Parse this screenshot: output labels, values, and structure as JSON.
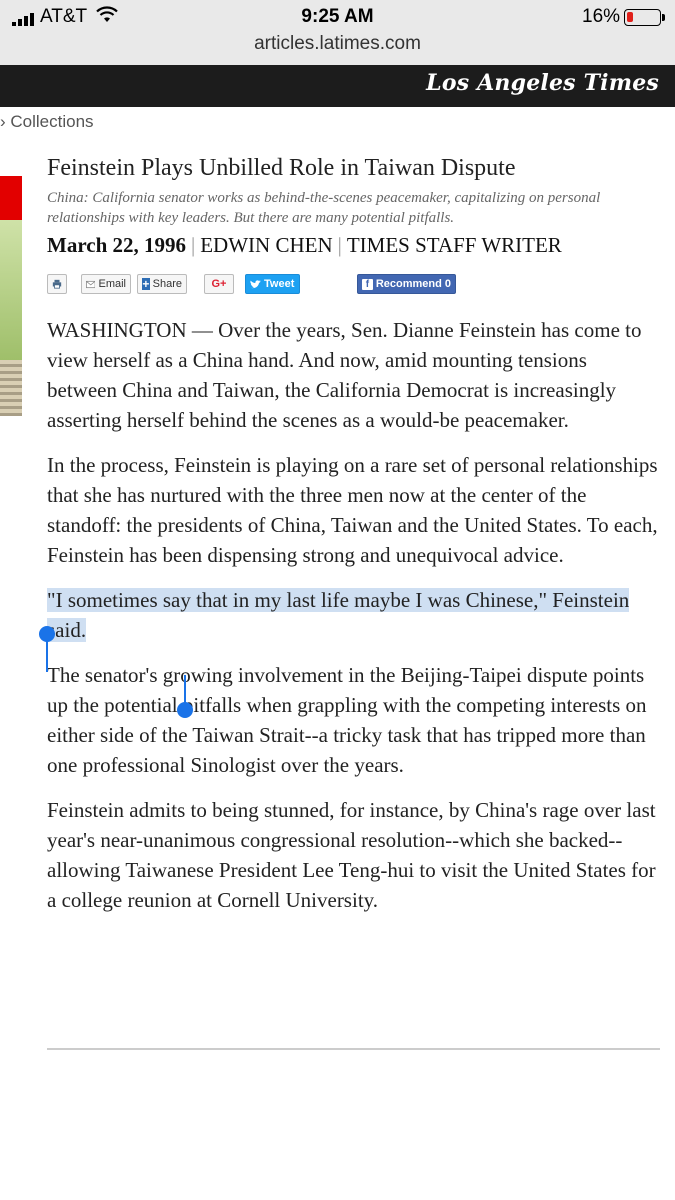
{
  "status_bar": {
    "carrier": "AT&T",
    "time": "9:25 AM",
    "battery": "16%"
  },
  "browser": {
    "url": "articles.latimes.com"
  },
  "site": {
    "logo": "Los Angeles Times"
  },
  "nav": {
    "collections": "Collections"
  },
  "article": {
    "title": "Feinstein Plays Unbilled Role in Taiwan Dispute",
    "subtitle": "China: California senator works as behind-the-scenes peacemaker, capitalizing on personal relationships with key leaders. But there are many potential pitfalls.",
    "date": "March 22, 1996",
    "author": "EDWIN CHEN",
    "role": "TIMES STAFF WRITER",
    "paragraphs": [
      "WASHINGTON — Over the years, Sen. Dianne Feinstein has come to view herself as a China hand. And now, amid mounting tensions between China and Taiwan, the California Democrat is increasingly asserting herself behind the scenes as a would-be peacemaker.",
      "In the process, Feinstein is playing on a rare set of personal relationships that she has nurtured with the three men now at the center of the standoff: the presidents of China, Taiwan and the United States. To each, Feinstein has been dispensing strong and unequivocal advice.",
      "\"I sometimes say that in my last life maybe I was Chinese,\" Feinstein said.",
      "The senator's growing involvement in the Beijing-Taipei dispute points up the potential pitfalls when grappling with the competing interests on either side of the Taiwan Strait--a tricky task that has tripped more than one professional Sinologist over the years.",
      "Feinstein admits to being stunned, for instance, by China's rage over last year's near-unanimous congressional resolution--which she backed--allowing Taiwanese President Lee Teng-hui to visit the United States for a college reunion at Cornell University."
    ]
  },
  "share_bar": {
    "email": "Email",
    "share": "Share",
    "gplus": "G+",
    "tweet": "Tweet",
    "recommend": "Recommend",
    "recommend_count": "0"
  },
  "selection_color": "#1a73e8"
}
